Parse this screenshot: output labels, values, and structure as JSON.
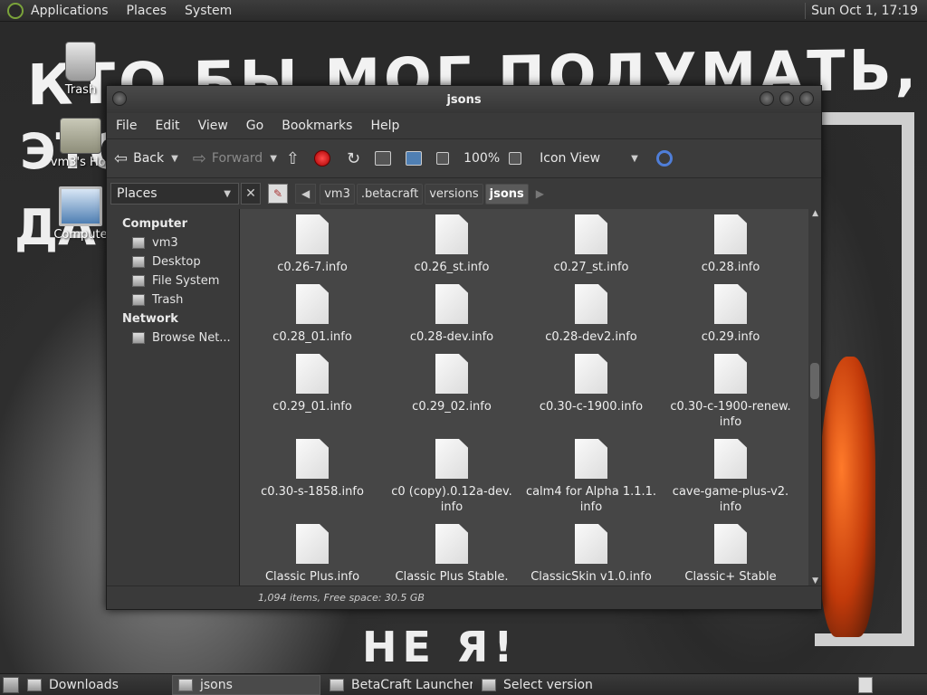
{
  "top_panel": {
    "menus": [
      "Applications",
      "Places",
      "System"
    ],
    "clock": "Sun Oct  1, 17:19"
  },
  "wallpaper": {
    "line1": "КТО БЫ МОГ ПОДУМАТЬ, ЧТО Я -",
    "line2": "ЭТО",
    "line3": "ДА",
    "line4": "НЕ Я!"
  },
  "desktop_icons": [
    {
      "label": "Trash"
    },
    {
      "label": "vm3's Hor"
    },
    {
      "label": "Compute"
    }
  ],
  "window": {
    "title": "jsons",
    "menu": [
      "File",
      "Edit",
      "View",
      "Go",
      "Bookmarks",
      "Help"
    ],
    "toolbar": {
      "back": "Back",
      "forward": "Forward",
      "zoom": "100%",
      "view_mode": "Icon View"
    },
    "places_label": "Places",
    "breadcrumbs": [
      "vm3",
      ".betacraft",
      "versions",
      "jsons"
    ],
    "sidebar": {
      "computer_heading": "Computer",
      "computer_items": [
        "vm3",
        "Desktop",
        "File System",
        "Trash"
      ],
      "network_heading": "Network",
      "network_items": [
        "Browse Net..."
      ]
    },
    "files": [
      [
        "c0.26-7.info",
        "c0.26_st.info",
        "c0.27_st.info",
        "c0.28.info"
      ],
      [
        "c0.28_01.info",
        "c0.28-dev.info",
        "c0.28-dev2.info",
        "c0.29.info"
      ],
      [
        "c0.29_01.info",
        "c0.29_02.info",
        "c0.30-c-1900.info",
        "c0.30-c-1900-renew.\ninfo"
      ],
      [
        "c0.30-s-1858.info",
        "c0 (copy).0.12a-dev.\ninfo",
        "calm4 for Alpha 1.1.1.\ninfo",
        "cave-game-plus-v2.\ninfo"
      ],
      [
        "Classic Plus.info",
        "Classic Plus Stable.",
        "ClassicSkin v1.0.info",
        "Classic+ Stable"
      ]
    ],
    "status": "1,094 items, Free space: 30.5 GB"
  },
  "taskbar": [
    {
      "label": "Downloads",
      "active": false
    },
    {
      "label": "jsons",
      "active": true
    },
    {
      "label": "BetaCraft Launcher ...",
      "active": false
    },
    {
      "label": "Select version",
      "active": false
    }
  ]
}
